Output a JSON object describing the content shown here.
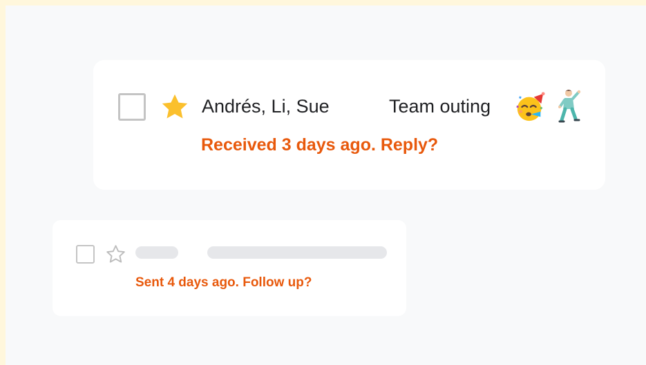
{
  "emails": [
    {
      "checkbox_checked": false,
      "starred": true,
      "sender": "Andrés, Li, Sue",
      "subject": "Team outing",
      "emoji": [
        "partying-face",
        "man-dancing"
      ],
      "nudge": "Received 3 days ago. Reply?"
    },
    {
      "checkbox_checked": false,
      "starred": false,
      "sender": "",
      "subject": "",
      "nudge": "Sent 4 days ago. Follow up?"
    }
  ],
  "colors": {
    "nudge": "#e8590c",
    "star": "#fbc02d",
    "background": "#f8f9fa",
    "frame": "#fff7dc",
    "card": "#ffffff"
  }
}
